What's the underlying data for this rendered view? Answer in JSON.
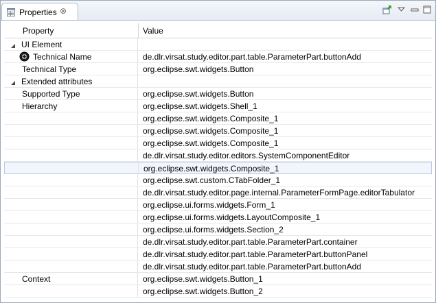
{
  "tab": {
    "title": "Properties",
    "close_glyph": "⊗",
    "icon": "properties-icon"
  },
  "toolbar": {
    "pin_icon": "pin-icon",
    "menu_icon": "view-menu-icon",
    "minimize_icon": "minimize-icon",
    "maximize_icon": "maximize-icon"
  },
  "table": {
    "headers": {
      "property": "Property",
      "value": "Value"
    },
    "rows": [
      {
        "property": "UI Element",
        "value": ""
      },
      {
        "property": "Technical Name",
        "value": "de.dlr.virsat.study.editor.part.table.ParameterPart.buttonAdd"
      },
      {
        "property": "Technical Type",
        "value": "org.eclipse.swt.widgets.Button"
      },
      {
        "property": "Extended attributes",
        "value": ""
      },
      {
        "property": "Supported Type",
        "value": "org.eclipse.swt.widgets.Button"
      },
      {
        "property": "Hierarchy",
        "value": "org.eclipse.swt.widgets.Shell_1"
      },
      {
        "property": "",
        "value": "org.eclipse.swt.widgets.Composite_1"
      },
      {
        "property": "",
        "value": "org.eclipse.swt.widgets.Composite_1"
      },
      {
        "property": "",
        "value": "org.eclipse.swt.widgets.Composite_1"
      },
      {
        "property": "",
        "value": "de.dlr.virsat.study.editor.editors.SystemComponentEditor"
      },
      {
        "property": "",
        "value": "org.eclipse.swt.widgets.Composite_1"
      },
      {
        "property": "",
        "value": "org.eclipse.swt.custom.CTabFolder_1"
      },
      {
        "property": "",
        "value": "de.dlr.virsat.study.editor.page.internal.ParameterFormPage.editorTabulator"
      },
      {
        "property": "",
        "value": "org.eclipse.ui.forms.widgets.Form_1"
      },
      {
        "property": "",
        "value": "org.eclipse.ui.forms.widgets.LayoutComposite_1"
      },
      {
        "property": "",
        "value": "org.eclipse.ui.forms.widgets.Section_2"
      },
      {
        "property": "",
        "value": "de.dlr.virsat.study.editor.part.table.ParameterPart.container"
      },
      {
        "property": "",
        "value": "de.dlr.virsat.study.editor.part.table.ParameterPart.buttonPanel"
      },
      {
        "property": "",
        "value": "de.dlr.virsat.study.editor.part.table.ParameterPart.buttonAdd"
      },
      {
        "property": "Context",
        "value": "org.eclipse.swt.widgets.Button_1"
      },
      {
        "property": "",
        "value": "org.eclipse.swt.widgets.Button_2"
      }
    ]
  }
}
